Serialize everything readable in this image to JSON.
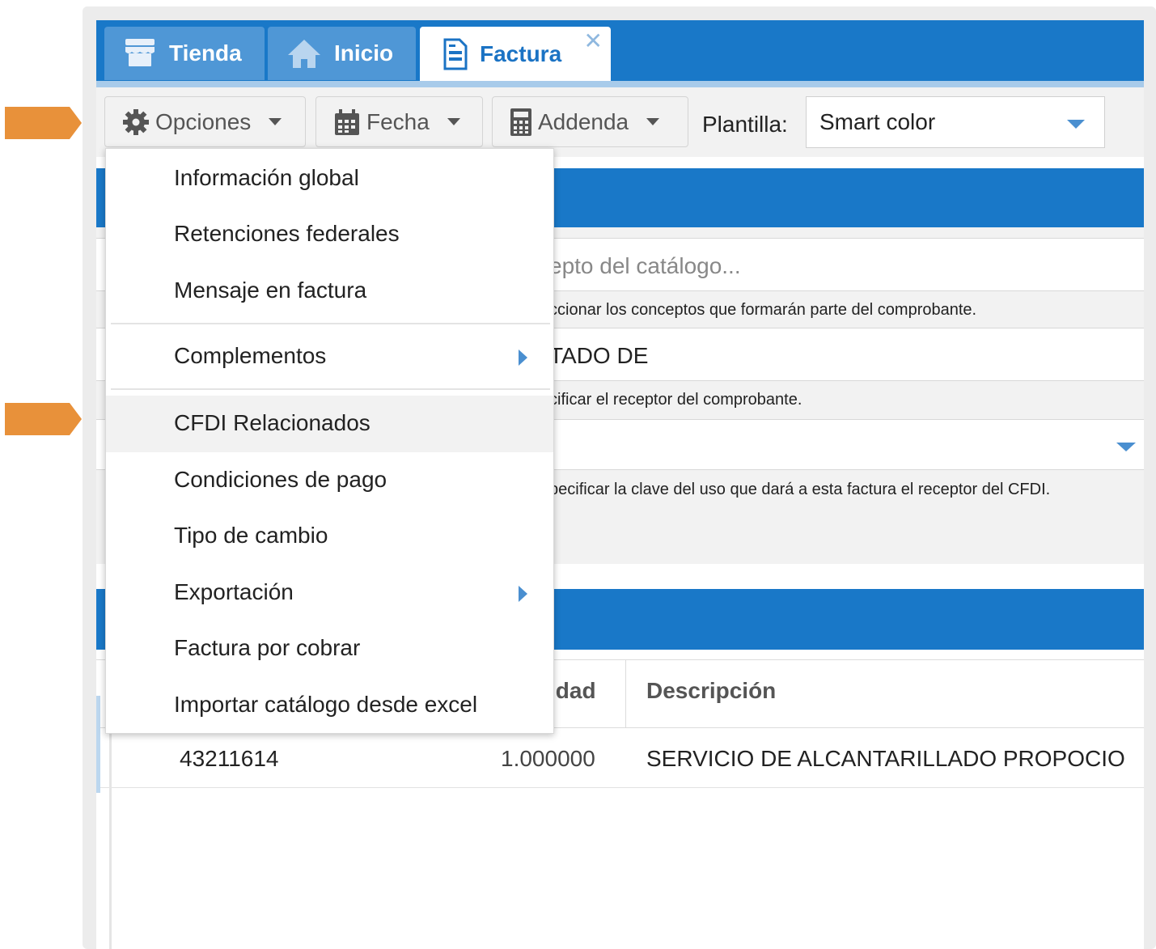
{
  "tabs": [
    {
      "label": "Tienda",
      "icon": "store-icon"
    },
    {
      "label": "Inicio",
      "icon": "home-icon"
    },
    {
      "label": "Factura",
      "icon": "document-icon",
      "close": "✕"
    }
  ],
  "toolbar": {
    "options_label": "Opciones",
    "date_label": "Fecha",
    "addenda_label": "Addenda",
    "template_label": "Plantilla:",
    "template_value": "Smart color"
  },
  "form": {
    "concept_placeholder": "epto del catálogo...",
    "concept_help": "ccionar los conceptos que formarán parte del comprobante.",
    "receptor_value": "TADO DE",
    "receptor_help": "cificar el receptor del comprobante.",
    "uso_help": "pecificar la clave del uso que dará a esta factura el receptor del CFDI."
  },
  "table": {
    "headers": [
      "idad",
      "Descripción"
    ],
    "rows": [
      {
        "code": "43211614",
        "qty": "1.000000",
        "desc": "SERVICIO DE ALCANTARILLADO PROPOCIO"
      }
    ]
  },
  "menu": {
    "items": [
      {
        "label": "Información global"
      },
      {
        "label": "Retenciones federales"
      },
      {
        "label": "Mensaje en factura"
      },
      {
        "label": "Complementos",
        "submenu": true
      },
      {
        "label": "CFDI Relacionados",
        "highlighted": true
      },
      {
        "label": "Condiciones de pago"
      },
      {
        "label": "Tipo de cambio"
      },
      {
        "label": "Exportación",
        "submenu": true
      },
      {
        "label": "Factura por cobrar"
      },
      {
        "label": "Importar catálogo desde excel"
      }
    ]
  },
  "colors": {
    "primary_blue": "#1978c8",
    "callout_orange": "#e8913a",
    "highlight_row": "#f2f2f2"
  }
}
